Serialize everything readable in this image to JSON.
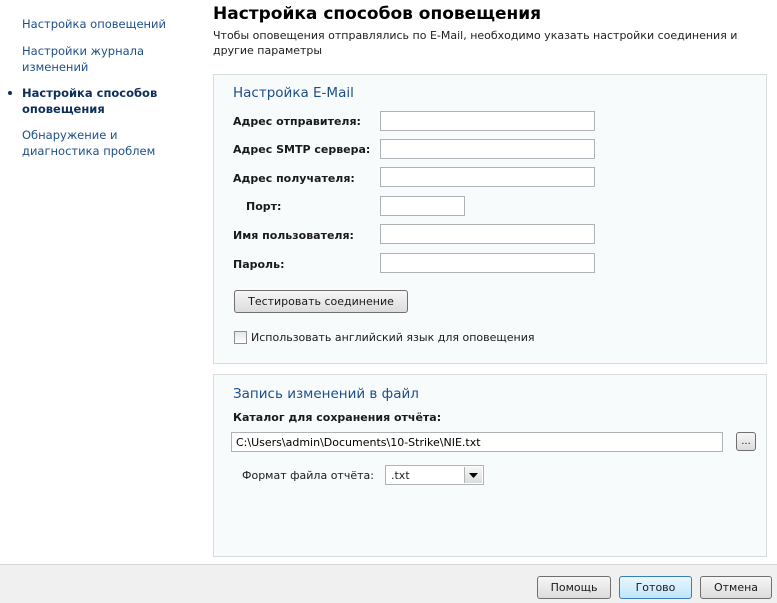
{
  "sidebar": {
    "items": [
      {
        "label": "Настройка оповещений"
      },
      {
        "label": "Настройки журнала изменений"
      },
      {
        "label": "Настройка способов оповещения"
      },
      {
        "label": "Обнаружение и диагностика проблем"
      }
    ]
  },
  "header": {
    "title": "Настройка способов оповещения",
    "subtitle": "Чтобы оповещения отправлялись по E-Mail, необходимо указать настройки соединения и другие параметры"
  },
  "email_panel": {
    "title": "Настройка E-Mail",
    "sender_label": "Адрес отправителя:",
    "sender_value": "",
    "smtp_label": "Адрес SMTP сервера:",
    "smtp_value": "",
    "recipient_label": "Адрес получателя:",
    "recipient_value": "",
    "port_label": "Порт:",
    "port_value": "",
    "username_label": "Имя пользователя:",
    "username_value": "",
    "password_label": "Пароль:",
    "password_value": "",
    "test_button": "Тестировать соединение",
    "english_checkbox_label": "Использовать английский язык для оповещения",
    "english_checked": false
  },
  "file_panel": {
    "title": "Запись изменений в файл",
    "catalog_label": "Каталог для сохранения отчёта:",
    "path_value": "C:\\Users\\admin\\Documents\\10-Strike\\NIE.txt",
    "browse_button": "...",
    "format_label": "Формат файла отчёта:",
    "format_value": ".txt"
  },
  "footer": {
    "help": "Помощь",
    "ok": "Готово",
    "cancel": "Отмена"
  }
}
